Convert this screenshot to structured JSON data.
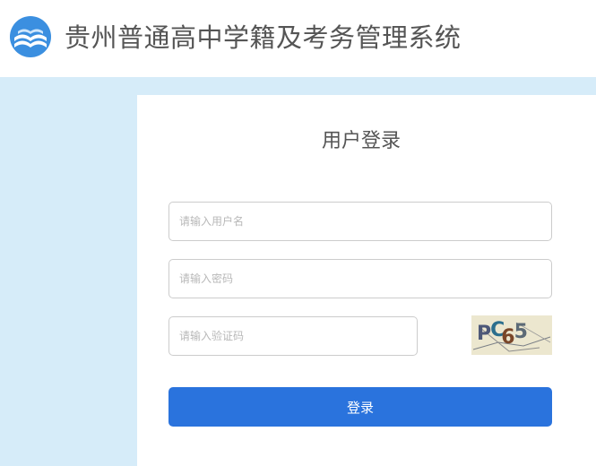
{
  "header": {
    "logo_icon": "book-wave-logo-icon",
    "title": "贵州普通高中学籍及考务管理系统"
  },
  "login": {
    "title": "用户登录",
    "username_placeholder": "请输入用户名",
    "password_placeholder": "请输入密码",
    "captcha_placeholder": "请输入验证码",
    "captcha_text": "PC65",
    "submit_label": "登录"
  },
  "colors": {
    "page_background": "#d6ecf9",
    "primary_button": "#2a73dd",
    "logo_blue": "#3b8fe0"
  }
}
